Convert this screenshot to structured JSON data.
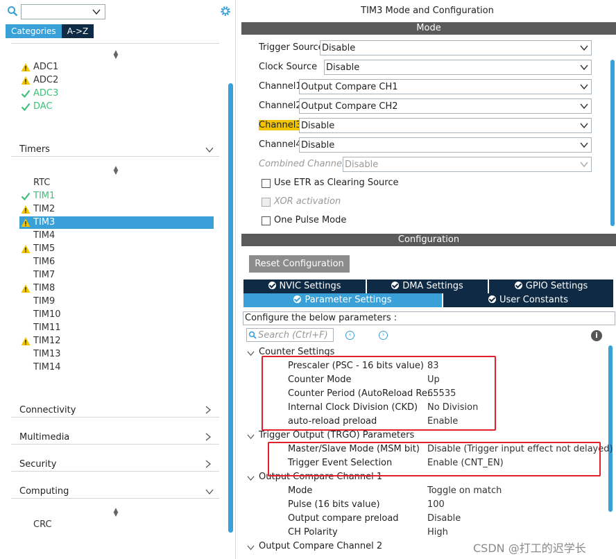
{
  "left": {
    "search_icon": "search-icon",
    "search_select_value": "",
    "gear_icon": "gear-icon",
    "tabs": [
      "Categories",
      "A->Z"
    ],
    "analog_items": [
      {
        "label": "ADC1",
        "status": "warning"
      },
      {
        "label": "ADC2",
        "status": "warning"
      },
      {
        "label": "ADC3",
        "status": "ok"
      },
      {
        "label": "DAC",
        "status": "ok"
      }
    ],
    "timers_label": "Timers",
    "timer_items": [
      {
        "label": "RTC",
        "status": "none"
      },
      {
        "label": "TIM1",
        "status": "ok"
      },
      {
        "label": "TIM2",
        "status": "warning"
      },
      {
        "label": "TIM3",
        "status": "warning",
        "selected": true
      },
      {
        "label": "TIM4",
        "status": "none"
      },
      {
        "label": "TIM5",
        "status": "warning"
      },
      {
        "label": "TIM6",
        "status": "none"
      },
      {
        "label": "TIM7",
        "status": "none"
      },
      {
        "label": "TIM8",
        "status": "warning"
      },
      {
        "label": "TIM9",
        "status": "none"
      },
      {
        "label": "TIM10",
        "status": "none"
      },
      {
        "label": "TIM11",
        "status": "none"
      },
      {
        "label": "TIM12",
        "status": "warning"
      },
      {
        "label": "TIM13",
        "status": "none"
      },
      {
        "label": "TIM14",
        "status": "none"
      }
    ],
    "categories": [
      "Connectivity",
      "Multimedia",
      "Security",
      "Computing"
    ],
    "computing_items": [
      {
        "label": "CRC",
        "status": "none"
      }
    ],
    "colors": {
      "accent": "#3aa0d8",
      "green": "#3dbf7a",
      "warning": "#f2c500",
      "dark_tab": "#0e2a44"
    }
  },
  "right": {
    "title": "TIM3 Mode and Configuration",
    "mode_bar": "Mode",
    "mode_rows": [
      {
        "label": "Trigger Source",
        "value": "Disable"
      },
      {
        "label": "Clock Source",
        "value": "Disable"
      },
      {
        "label": "Channel1",
        "value": "Output Compare CH1"
      },
      {
        "label": "Channel2",
        "value": "Output Compare CH2"
      },
      {
        "label": "Channel3",
        "value": "Disable",
        "highlighted": true
      },
      {
        "label": "Channel4",
        "value": "Disable"
      },
      {
        "label": "Combined Channels",
        "value": "Disable",
        "disabled": true
      }
    ],
    "checkboxes": [
      {
        "label": "Use ETR as Clearing Source",
        "checked": false
      },
      {
        "label": "XOR activation",
        "checked": false,
        "disabled": true
      },
      {
        "label": "One Pulse Mode",
        "checked": false
      }
    ],
    "config_bar": "Configuration",
    "reset_button": "Reset Configuration",
    "config_tabs_row1": [
      "NVIC Settings",
      "DMA Settings",
      "GPIO Settings"
    ],
    "config_tabs_row2": [
      "Parameter Settings",
      "User Constants"
    ],
    "configure_text": "Configure the below parameters :",
    "search_placeholder": "Search (Ctrl+F)",
    "info_icon": "info-icon",
    "groups": [
      {
        "title": "Counter Settings",
        "params": [
          {
            "name": "Prescaler (PSC - 16 bits value)",
            "value": "83"
          },
          {
            "name": "Counter Mode",
            "value": "Up"
          },
          {
            "name": "Counter Period (AutoReload Re...",
            "value": "65535"
          },
          {
            "name": "Internal Clock Division (CKD)",
            "value": "No Division"
          },
          {
            "name": "auto-reload preload",
            "value": "Enable"
          }
        ]
      },
      {
        "title": "Trigger Output (TRGO) Parameters",
        "params": [
          {
            "name": "Master/Slave Mode (MSM bit)",
            "value": "Disable (Trigger input effect not delayed)"
          },
          {
            "name": "Trigger Event Selection",
            "value": "Enable (CNT_EN)"
          }
        ]
      },
      {
        "title": "Output Compare Channel 1",
        "params": [
          {
            "name": "Mode",
            "value": "Toggle on match"
          },
          {
            "name": "Pulse (16 bits value)",
            "value": "100"
          },
          {
            "name": "Output compare preload",
            "value": "Disable"
          },
          {
            "name": "CH Polarity",
            "value": "High"
          }
        ]
      },
      {
        "title": "Output Compare Channel 2",
        "params": []
      }
    ],
    "watermark": "CSDN @打工的迟学长"
  }
}
